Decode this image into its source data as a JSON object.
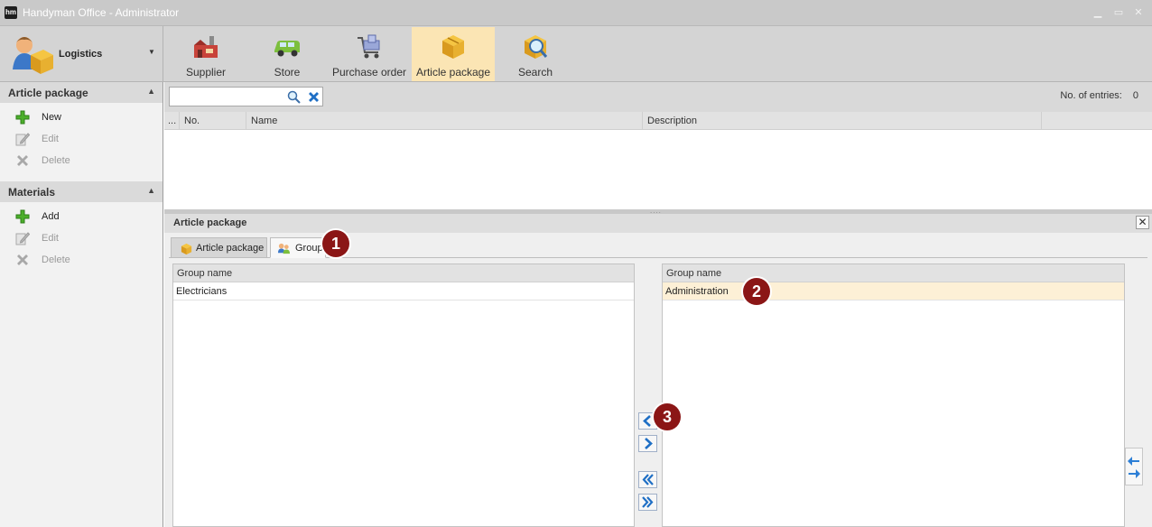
{
  "window": {
    "logo_text": "hm",
    "title": "Handyman Office - Administrator",
    "minimize_icon": "minimize-icon",
    "maximize_icon": "maximize-icon",
    "close_icon": "close-icon"
  },
  "ribbon": {
    "module": {
      "label": "Logistics",
      "icon": "logistics-icon"
    },
    "buttons": [
      {
        "label": "Supplier",
        "icon": "supplier-icon"
      },
      {
        "label": "Store",
        "icon": "store-icon"
      },
      {
        "label": "Purchase order",
        "icon": "purchase-order-icon"
      },
      {
        "label": "Article package",
        "icon": "article-package-icon",
        "active": true
      },
      {
        "label": "Search",
        "icon": "search-icon"
      }
    ]
  },
  "sidebar": {
    "sections": [
      {
        "title": "Article package",
        "items": [
          {
            "label": "New",
            "icon": "plus-icon",
            "enabled": true
          },
          {
            "label": "Edit",
            "icon": "edit-icon",
            "enabled": false
          },
          {
            "label": "Delete",
            "icon": "delete-icon",
            "enabled": false
          }
        ]
      },
      {
        "title": "Materials",
        "items": [
          {
            "label": "Add",
            "icon": "plus-icon",
            "enabled": true
          },
          {
            "label": "Edit",
            "icon": "edit-icon",
            "enabled": false
          },
          {
            "label": "Delete",
            "icon": "delete-icon",
            "enabled": false
          }
        ]
      }
    ]
  },
  "search": {
    "value": "",
    "entries_label": "No. of entries:",
    "entries_count": "0"
  },
  "grid": {
    "columns": [
      "...",
      "No.",
      "Name",
      "Description"
    ],
    "rows": []
  },
  "detail": {
    "title": "Article package",
    "tabs": [
      {
        "label": "Article package",
        "active": false
      },
      {
        "label": "Groups",
        "active": true
      }
    ],
    "available_groups": {
      "header": "Group name",
      "rows": [
        "Electricians"
      ]
    },
    "assigned_groups": {
      "header": "Group name",
      "rows": [
        "Administration"
      ]
    },
    "move_buttons": [
      {
        "name": "move-left",
        "icon": "chevron-left-icon"
      },
      {
        "name": "move-right",
        "icon": "chevron-right-icon"
      },
      {
        "name": "move-all-left",
        "icon": "double-chevron-left-icon"
      },
      {
        "name": "move-all-right",
        "icon": "double-chevron-right-icon"
      }
    ]
  },
  "callouts": [
    "1",
    "2",
    "3"
  ],
  "colors": {
    "ribbon_active": "#fbe5b4",
    "selected_row": "#fdf0d6",
    "callout": "#8b1616"
  }
}
